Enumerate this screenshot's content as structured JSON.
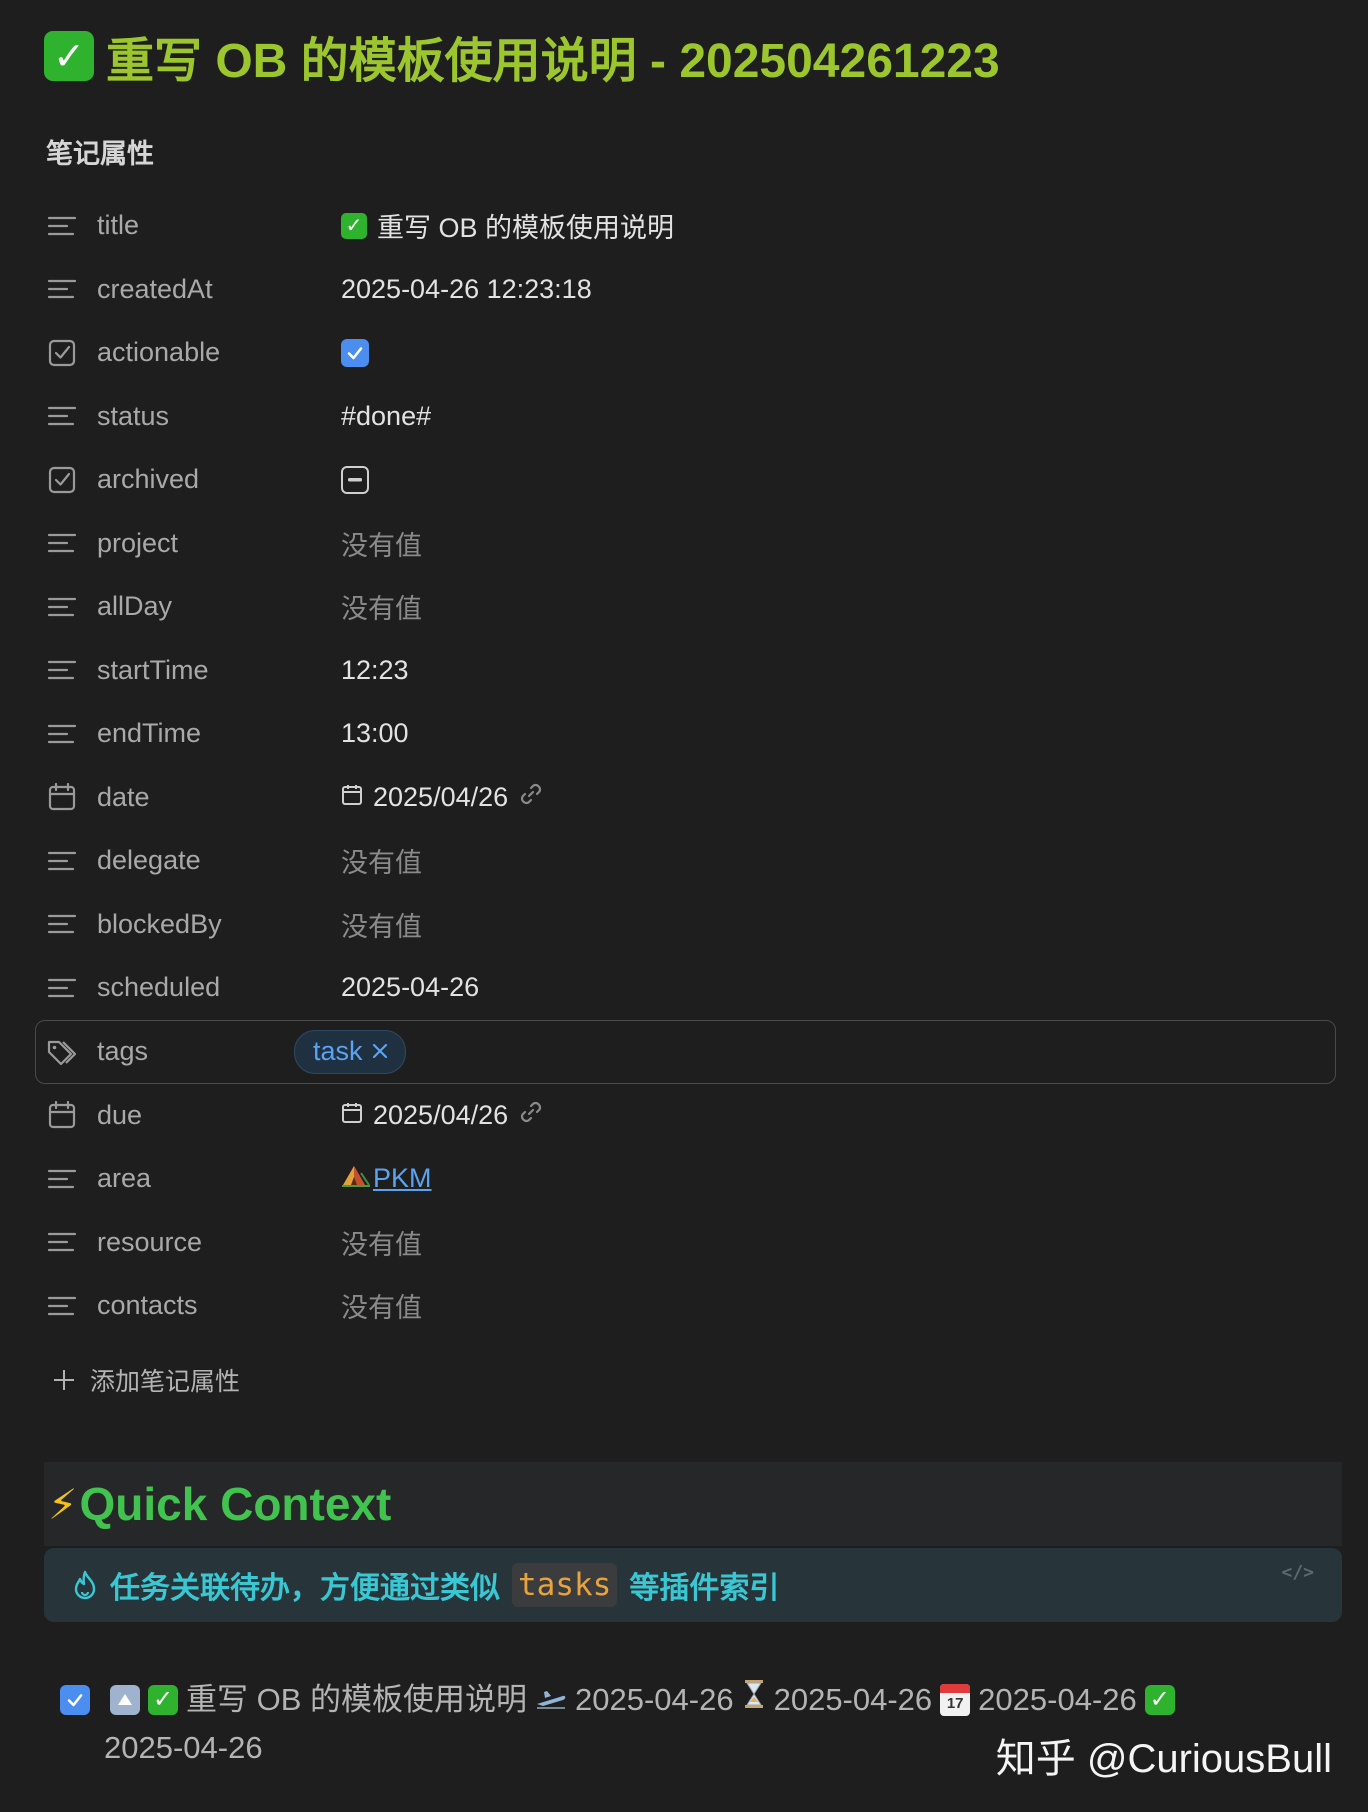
{
  "page": {
    "title_text": "重写 OB 的模板使用说明 - 202504261223",
    "section_heading": "笔记属性"
  },
  "properties": [
    {
      "key": "title",
      "icon": "text-lines-icon",
      "value": "重写 OB 的模板使用说明",
      "value_emoji": "check-mark-emoji"
    },
    {
      "key": "createdAt",
      "icon": "text-lines-icon",
      "value": "2025-04-26 12:23:18"
    },
    {
      "key": "actionable",
      "icon": "checkbox-icon",
      "value_type": "checkbox",
      "checked": true
    },
    {
      "key": "status",
      "icon": "text-lines-icon",
      "value": "#done#"
    },
    {
      "key": "archived",
      "icon": "checkbox-icon",
      "value_type": "checkbox",
      "checked": "indeterminate"
    },
    {
      "key": "project",
      "icon": "text-lines-icon",
      "value": "没有值",
      "empty": true
    },
    {
      "key": "allDay",
      "icon": "text-lines-icon",
      "value": "没有值",
      "empty": true
    },
    {
      "key": "startTime",
      "icon": "text-lines-icon",
      "value": "12:23"
    },
    {
      "key": "endTime",
      "icon": "text-lines-icon",
      "value": "13:00"
    },
    {
      "key": "date",
      "icon": "calendar-icon",
      "value": "2025/04/26",
      "value_type": "date"
    },
    {
      "key": "delegate",
      "icon": "text-lines-icon",
      "value": "没有值",
      "empty": true
    },
    {
      "key": "blockedBy",
      "icon": "text-lines-icon",
      "value": "没有值",
      "empty": true
    },
    {
      "key": "scheduled",
      "icon": "text-lines-icon",
      "value": "2025-04-26"
    },
    {
      "key": "tags",
      "icon": "tags-icon",
      "value": "task",
      "value_type": "tag"
    },
    {
      "key": "due",
      "icon": "calendar-icon",
      "value": "2025/04/26",
      "value_type": "date"
    },
    {
      "key": "area",
      "icon": "text-lines-icon",
      "value": "PKM",
      "value_type": "link",
      "value_emoji": "tent-emoji"
    },
    {
      "key": "resource",
      "icon": "text-lines-icon",
      "value": "没有值",
      "empty": true
    },
    {
      "key": "contacts",
      "icon": "text-lines-icon",
      "value": "没有值",
      "empty": true
    }
  ],
  "add_property_label": "添加笔记属性",
  "quick_context": {
    "heading": "Quick Context",
    "callout_text_before": "任务关联待办，方便通过类似",
    "callout_code": "tasks",
    "callout_text_after": "等插件索引",
    "code_badge": "</>"
  },
  "task": {
    "title": "重写 OB 的模板使用说明",
    "created": "2025-04-26",
    "scheduled": "2025-04-26",
    "due": "2025-04-26",
    "done": "2025-04-26",
    "calendar_emoji_day": "17"
  },
  "watermark": "知乎 @CuriousBull",
  "colors": {
    "background": "#1e1e1e",
    "title_green": "#9cc62e",
    "heading_green": "#42c24e",
    "callout_cyan": "#39c7d3",
    "link_blue": "#5aa3f0",
    "checkbox_blue": "#4b8ef0",
    "code_orange": "#e8a33d"
  }
}
